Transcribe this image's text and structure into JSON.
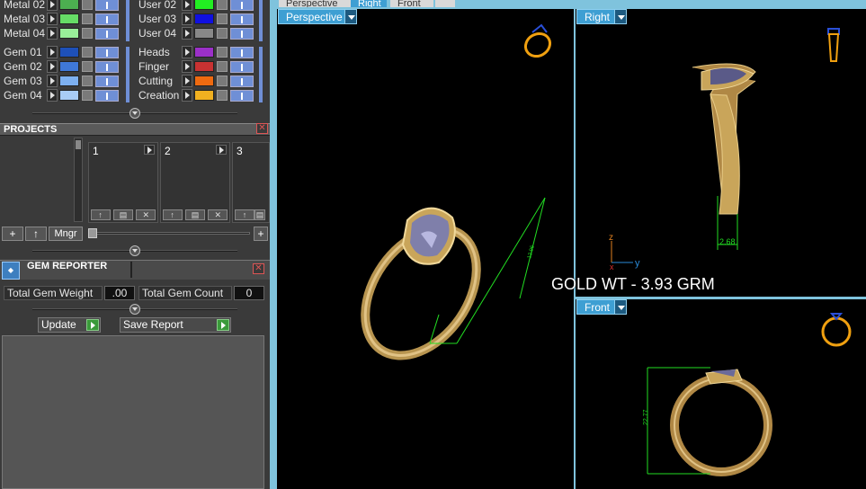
{
  "layers_left": [
    {
      "name": "Metal 02",
      "color": "#4caf50"
    },
    {
      "name": "Metal 03",
      "color": "#66dd66"
    },
    {
      "name": "Metal 04",
      "color": "#99ee99"
    },
    {
      "name": "Gem 01",
      "color": "#1e50b8"
    },
    {
      "name": "Gem 02",
      "color": "#3f78d8"
    },
    {
      "name": "Gem 03",
      "color": "#7db0f0"
    },
    {
      "name": "Gem 04",
      "color": "#a8ccf5"
    }
  ],
  "layers_right": [
    {
      "name": "User 02",
      "color": "#22ee22"
    },
    {
      "name": "User 03",
      "color": "#1010e0"
    },
    {
      "name": "User 04",
      "color": "#888888"
    },
    {
      "name": "Heads",
      "color": "#9b30c8"
    },
    {
      "name": "Finger",
      "color": "#c83232"
    },
    {
      "name": "Cutting",
      "color": "#ee6a10"
    },
    {
      "name": "Creation",
      "color": "#f0b020"
    }
  ],
  "projects": {
    "title": "PROJECTS",
    "items": [
      "1",
      "2",
      "3"
    ],
    "add_label": "+",
    "up_label": "↑",
    "manager_label": "Mngr",
    "zoom_plus": "+"
  },
  "gem_reporter": {
    "title": "GEM REPORTER",
    "total_weight_label": "Total Gem Weight",
    "total_weight_value": ".00",
    "total_count_label": "Total Gem Count",
    "total_count_value": "0",
    "update_label": "Update",
    "save_label": "Save Report"
  },
  "tabs": [
    "Perspective",
    "Right",
    "Front",
    ""
  ],
  "viewports": {
    "perspective": "Perspective",
    "right": "Right",
    "front": "Front"
  },
  "dimensions": {
    "right_dim": "2.68",
    "front_dim": "22.77",
    "persp_dim": "12.96"
  },
  "axes": {
    "z": "z",
    "x": "x",
    "y": "y"
  },
  "overlay_text": "GOLD WT - 3.93 GRM",
  "colors": {
    "accent": "#3e9fd3",
    "gold": "#c9a55a",
    "dimension": "#22dd22",
    "gem": "#6a6a9a"
  }
}
